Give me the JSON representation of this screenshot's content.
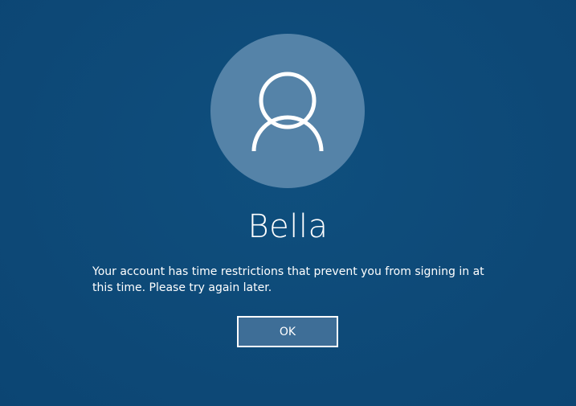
{
  "user": {
    "name": "Bella",
    "avatar_icon": "person-icon"
  },
  "message": {
    "text": "Your account has time restrictions that prevent you from signing in at this time. Please try again later."
  },
  "actions": {
    "ok_label": "OK"
  },
  "colors": {
    "background": "#0e4b79",
    "avatar_circle": "#5583a8",
    "button_fill": "#3e6e97",
    "foreground": "#ffffff"
  }
}
